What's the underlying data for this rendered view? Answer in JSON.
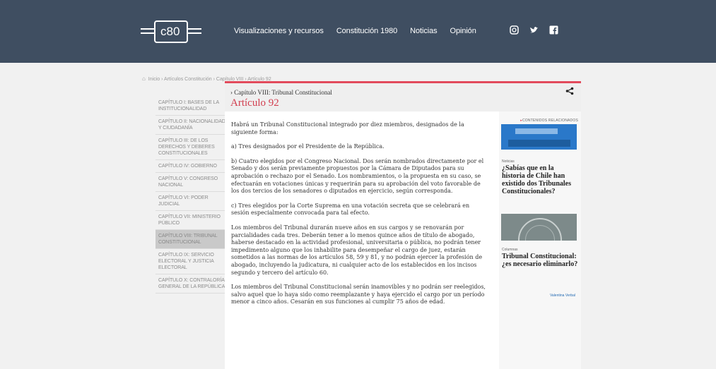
{
  "header": {
    "logo_text": "c80",
    "nav": [
      "Visualizaciones y recursos",
      "Constitución 1980",
      "Noticias",
      "Opinión"
    ],
    "social_icons": [
      "instagram-icon",
      "twitter-icon",
      "facebook-icon"
    ]
  },
  "breadcrumb": "Inicio › Artículos Constitución › Capítulo VIII › Artículo 92",
  "sidebar": {
    "items": [
      "CAPÍTULO I: BASES DE LA INSTITUCIONALIDAD",
      "CAPÍTULO II: NACIONALIDAD Y CIUDADANÍA",
      "CAPÍTULO III: DE LOS DERECHOS Y DEBERES CONSTITUCIONALES",
      "CAPÍTULO IV: GOBIERNO",
      "CAPÍTULO V: CONGRESO NACIONAL",
      "CAPÍTULO VI: PODER JUDICIAL",
      "CAPÍTULO VII: MINISTERIO PÚBLICO",
      "CAPÍTULO VIII: TRIBUNAL CONSTITUCIONAL",
      "CAPÍTULO IX: SERVICIO ELECTORAL Y JUSTICIA ELECTORAL",
      "CAPÍTULO X: CONTRALORÍA GENERAL DE LA REPÚBLICA"
    ],
    "active_index": 7
  },
  "article": {
    "chapter": "› Capítulo VIII: Tribunal Constitucional",
    "title": "Artículo 92",
    "paragraphs": [
      "Habrá un Tribunal Constitucional integrado por diez miembros, designados de la siguiente forma:",
      "a) Tres designados por el Presidente de la República.",
      "b) Cuatro elegidos por el Congreso Nacional. Dos serán nombrados directamente por el Senado y dos serán previamente propuestos por la Cámara de Diputados para su aprobación o rechazo por el Senado. Los nombramientos, o la propuesta en su caso, se efectuarán en votaciones únicas y requerirán para su aprobación del voto favorable de los dos tercios de los senadores o diputados en ejercicio, según corresponda.",
      "c) Tres elegidos por la Corte Suprema en una votación secreta que se celebrará en sesión especialmente convocada para tal efecto.",
      "Los miembros del Tribunal durarán nueve años en sus cargos y se renovarán por parcialidades cada tres. Deberán tener a lo menos quince años de título de abogado, haberse destacado en la actividad profesional, universitaria o pública, no podrán tener impedimento alguno que los inhabilite para desempeñar el cargo de juez, estarán sometidos a las normas de los artículos 58, 59 y 81, y no podrán ejercer la profesión de abogado, incluyendo la judicatura, ni cualquier acto de los establecidos en los incisos segundo y tercero del artículo 60.",
      "Los miembros del Tribunal Constitucional serán inamovibles y no podrán ser reelegidos, salvo aquel que lo haya sido como reemplazante y haya ejercido el cargo por un período menor a cinco años. Cesarán en sus funciones al cumplir 75 años de edad."
    ]
  },
  "related": {
    "heading": "CONTENIDOS RELACIONADOS",
    "items": [
      {
        "category": "Noticias",
        "title": "¿Sabías que en la historia de Chile han existido dos Tribunales Constitucionales?"
      },
      {
        "category": "Columnas",
        "title": "Tribunal Constitucional: ¿es necesario eliminarlo?",
        "author": "Valentina Verbal"
      }
    ]
  }
}
